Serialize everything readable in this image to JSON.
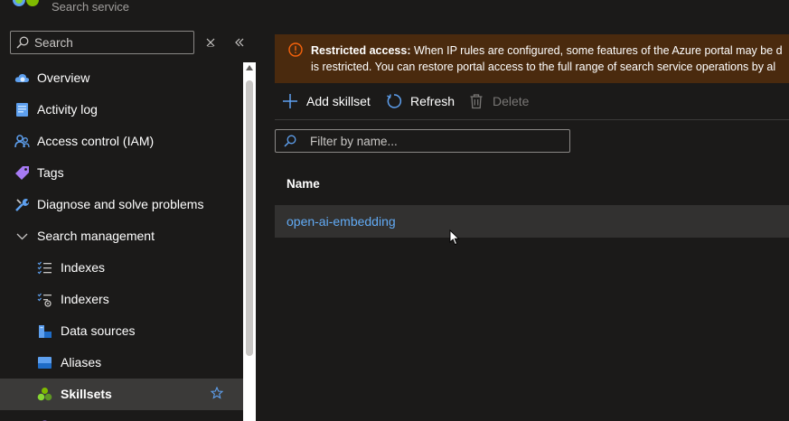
{
  "brand": {
    "subtitle": "Search service"
  },
  "sidebar": {
    "search_placeholder": "Search",
    "items": [
      {
        "label": "Overview",
        "icon": "overview-cloud-icon"
      },
      {
        "label": "Activity log",
        "icon": "activity-log-icon"
      },
      {
        "label": "Access control (IAM)",
        "icon": "people-icon"
      },
      {
        "label": "Tags",
        "icon": "tag-icon"
      },
      {
        "label": "Diagnose and solve problems",
        "icon": "wrench-icon"
      },
      {
        "label": "Search management",
        "icon": "chevron-down-icon",
        "expanded": true
      },
      {
        "label": "Indexes",
        "icon": "indexes-list-icon"
      },
      {
        "label": "Indexers",
        "icon": "indexers-icon"
      },
      {
        "label": "Data sources",
        "icon": "data-sources-icon"
      },
      {
        "label": "Aliases",
        "icon": "aliases-icon"
      },
      {
        "label": "Skillsets",
        "icon": "skillsets-icon",
        "active": true
      }
    ]
  },
  "banner": {
    "title": "Restricted access:",
    "line1": "When IP rules are configured, some features of the Azure portal may be d",
    "line2": "is restricted. You can restore portal access to the full range of search service operations by al"
  },
  "toolbar": {
    "add_label": "Add skillset",
    "refresh_label": "Refresh",
    "delete_label": "Delete"
  },
  "filter": {
    "placeholder": "Filter by name..."
  },
  "table": {
    "column": "Name",
    "rows": [
      {
        "name": "open-ai-embedding"
      }
    ]
  },
  "colors": {
    "accent": "#62abf5",
    "banner_bg": "#4a2a0e",
    "warning": "#f7630c",
    "background": "#1b1a19"
  }
}
